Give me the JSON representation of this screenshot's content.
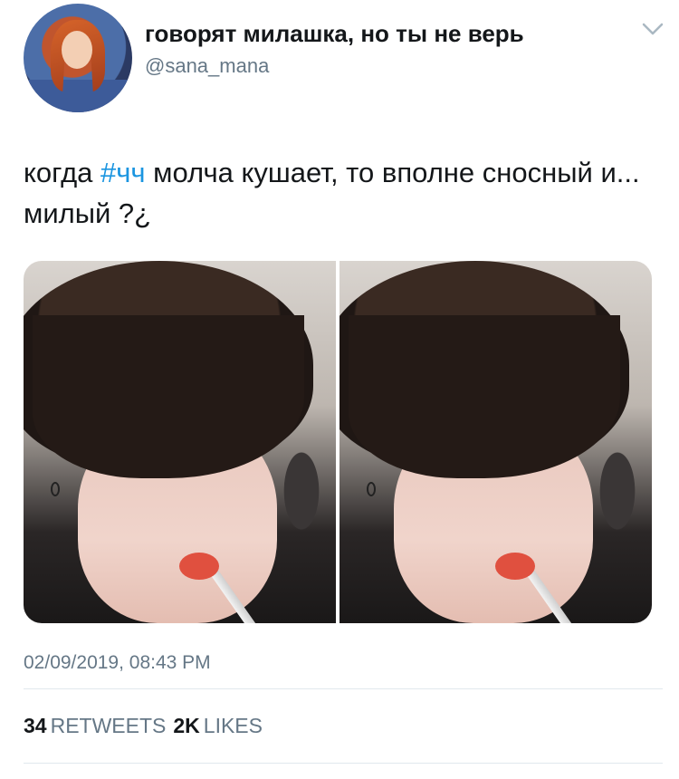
{
  "tweet": {
    "display_name": "говорят милашка, но ты не верь",
    "handle": "@sana_mana",
    "text_before": "когда ",
    "hashtag": "#чч",
    "text_after": " молча кушает, то вполне сносный и... милый ?¿",
    "timestamp": "02/09/2019, 08:43 PM",
    "retweets_count": "34",
    "retweets_label": "RETWEETS",
    "likes_count": "2K",
    "likes_label": "LIKES"
  },
  "icons": {
    "menu": "chevron-down-icon"
  },
  "colors": {
    "hashtag": "#1b95e0",
    "secondary_text": "#657786",
    "primary_text": "#14171a"
  }
}
